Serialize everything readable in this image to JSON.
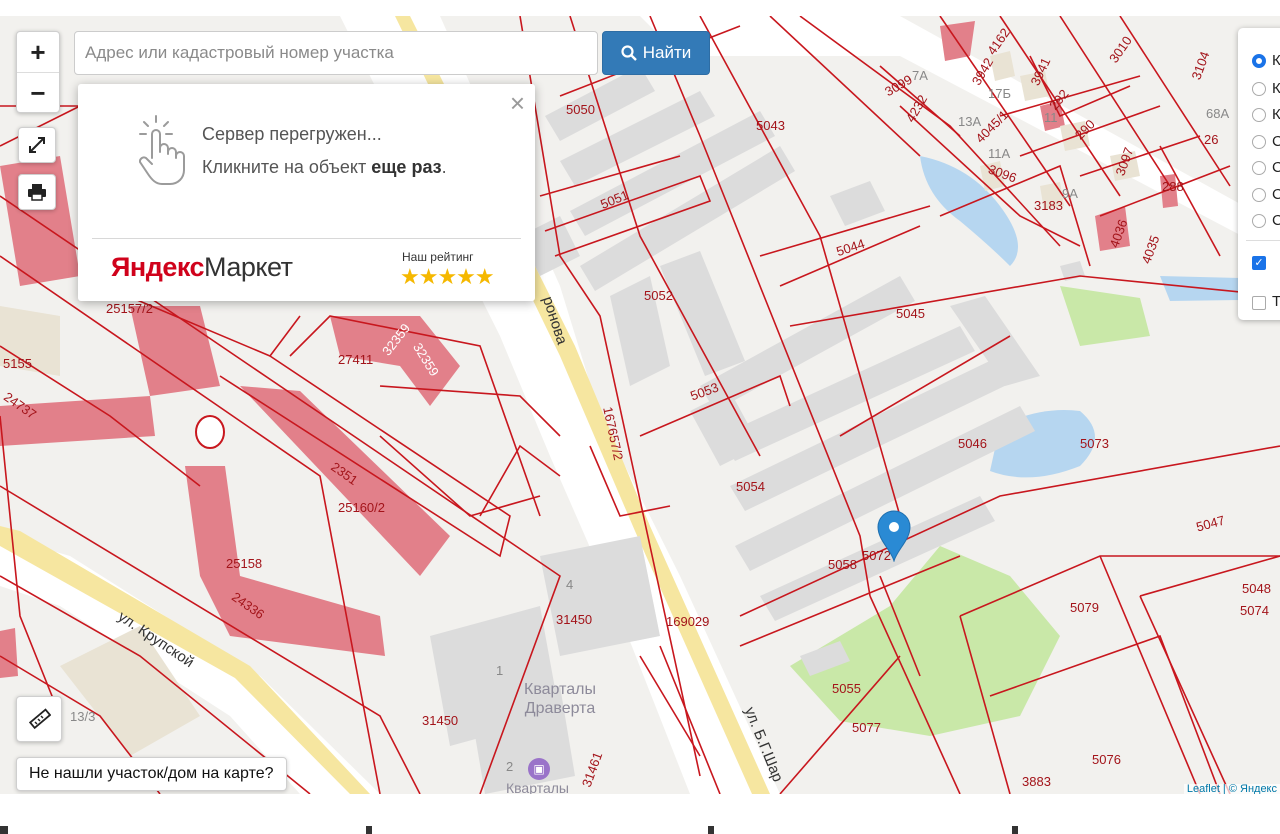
{
  "search": {
    "placeholder": "Адрес или кадастровый номер участка",
    "button_label": "Найти"
  },
  "popup": {
    "line1": "Сервер перегружен...",
    "line2_prefix": "Кликните на объект ",
    "line2_bold": "еще раз",
    "line2_suffix": ".",
    "brand_y": "Яндекс",
    "brand_m": "Маркет",
    "rating_label": "Наш рейтинг",
    "stars": "★★★★★"
  },
  "controls": {
    "zoom_in": "+",
    "zoom_out": "−"
  },
  "not_found_label": "Не нашли участок/дом на карте?",
  "attribution": "Leaflet | © Яндекс",
  "layers": {
    "radios": [
      "К",
      "К",
      "К",
      "С",
      "С",
      "С",
      "С"
    ],
    "selected_index": 0,
    "checkboxes": [
      {
        "label": "",
        "checked": true
      },
      {
        "label": "Т",
        "checked": false
      }
    ]
  },
  "map": {
    "parcels": [
      "5050",
      "5043",
      "5051",
      "5044",
      "5052",
      "5045",
      "5053",
      "5046",
      "5073",
      "5054",
      "5047",
      "5058",
      "5072",
      "5079",
      "5048",
      "5074",
      "5055",
      "5077",
      "5076",
      "3883",
      "31450",
      "31450",
      "169029",
      "167657/2",
      "27411",
      "32359",
      "32359",
      "25157/2",
      "5155",
      "24737",
      "2351",
      "25160/2",
      "25158",
      "24336",
      "31461",
      "3099",
      "3942",
      "4162",
      "3941",
      "292",
      "3010",
      "3104",
      "4232",
      "4045/1",
      "3096",
      "3183",
      "290",
      "3097",
      "288",
      "4036",
      "4035",
      "26",
      "68А",
      "13А",
      "11А",
      "17Б",
      "7А",
      "9А",
      "11",
      "1",
      "2",
      "4",
      "13/3"
    ],
    "streets": [
      "ул. Крупской",
      "ул. Б.Г.Шар",
      "ронова"
    ],
    "poi": "Кварталы Драверта",
    "poi2": "Кварталы"
  },
  "colors": {
    "parcel_line": "#c8171e",
    "building": "#e2808a",
    "button": "#337ab7",
    "marker": "#2a8ad4"
  }
}
